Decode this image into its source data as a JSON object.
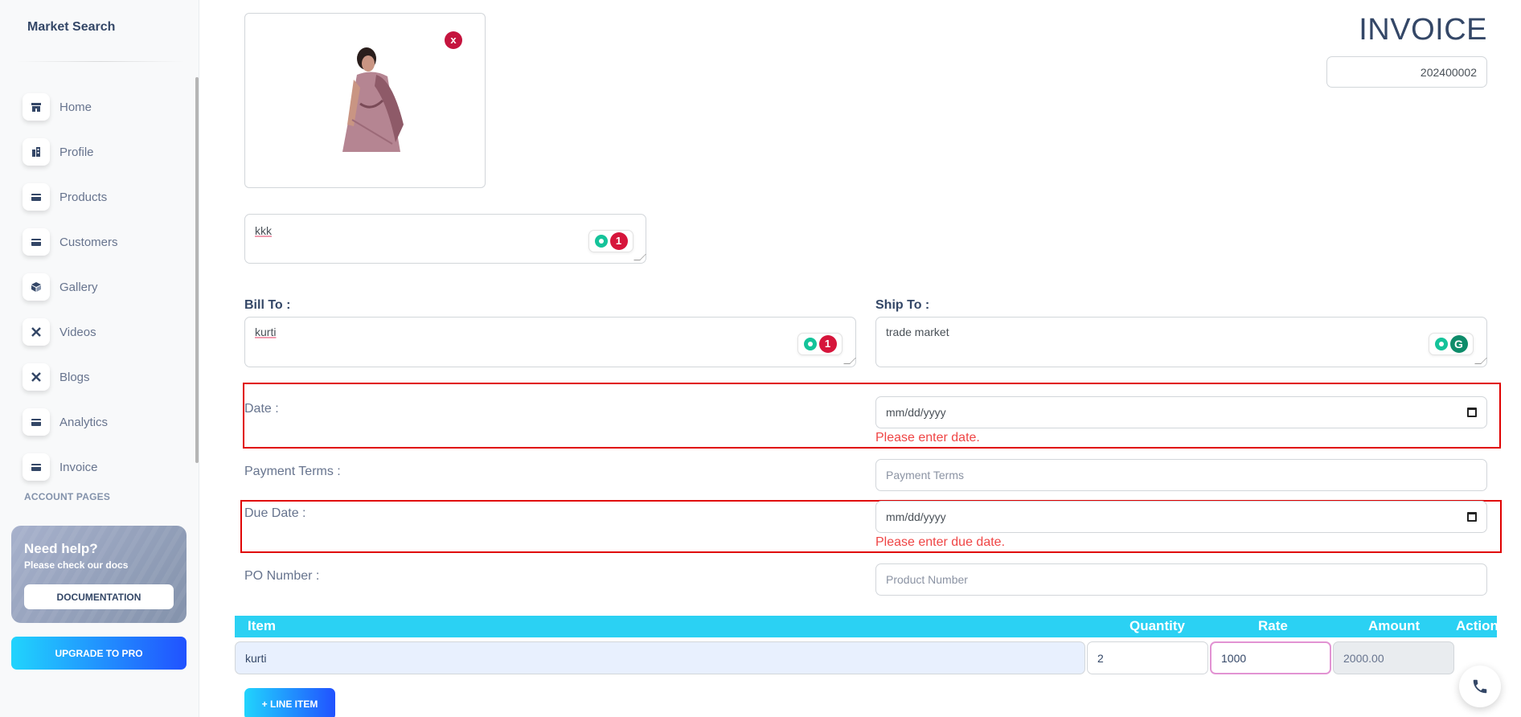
{
  "brand": "Market Search",
  "sidebar": {
    "items": [
      {
        "label": "Home",
        "icon": "shop-icon"
      },
      {
        "label": "Profile",
        "icon": "office-icon"
      },
      {
        "label": "Products",
        "icon": "credit-card-icon"
      },
      {
        "label": "Customers",
        "icon": "credit-card-icon"
      },
      {
        "label": "Gallery",
        "icon": "box-3d-icon"
      },
      {
        "label": "Videos",
        "icon": "settings-tools-icon"
      },
      {
        "label": "Blogs",
        "icon": "settings-tools-icon"
      },
      {
        "label": "Analytics",
        "icon": "credit-card-icon"
      },
      {
        "label": "Invoice",
        "icon": "credit-card-icon"
      }
    ],
    "section_title": "ACCOUNT PAGES",
    "help_card": {
      "title": "Need help?",
      "subtitle": "Please check our docs",
      "button": "DOCUMENTATION"
    },
    "upgrade_button": "UPGRADE TO PRO"
  },
  "invoice": {
    "title": "INVOICE",
    "number": "202400002",
    "close_label": "x",
    "note": "kkk",
    "bill_to_label": "Bill To :",
    "bill_to_value": "kurti",
    "ship_to_label": "Ship To :",
    "ship_to_value": "trade market",
    "grammar_count": "1",
    "grammar_g": "G",
    "date_label": "Date :",
    "date_placeholder": "mm/dd/yyyy",
    "date_error": "Please enter date.",
    "payment_terms_label": "Payment Terms :",
    "payment_terms_placeholder": "Payment Terms",
    "due_date_label": "Due Date :",
    "due_date_placeholder": "mm/dd/yyyy",
    "due_date_error": "Please enter due date.",
    "po_number_label": "PO Number :",
    "po_number_placeholder": "Product Number"
  },
  "table": {
    "headers": {
      "item": "Item",
      "quantity": "Quantity",
      "rate": "Rate",
      "amount": "Amount",
      "action": "Action"
    },
    "rows": [
      {
        "item": "kurti",
        "quantity": "2",
        "rate": "1000",
        "amount": "2000.00"
      }
    ],
    "add_button": "+ LINE ITEM"
  },
  "colors": {
    "accent_start": "#21d4fd",
    "accent_end": "#2152ff",
    "error": "#ea0606",
    "table_header": "#2bd1f3"
  }
}
